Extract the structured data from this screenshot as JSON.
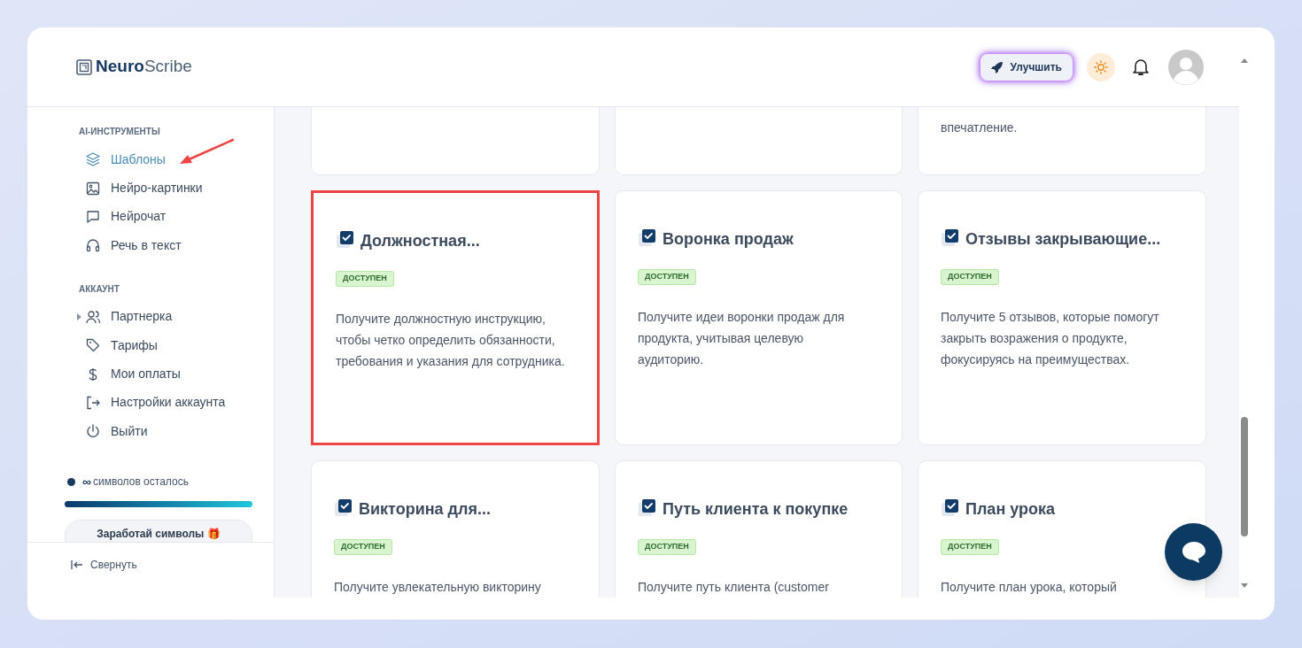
{
  "brand": {
    "bold": "Neuro",
    "light": "Scribe"
  },
  "header": {
    "upgrade_button": "Улучшить"
  },
  "sidebar": {
    "sections": [
      {
        "title": "AI-ИНСТРУМЕНТЫ",
        "items": [
          {
            "label": "Шаблоны",
            "selected": true
          },
          {
            "label": "Нейро-картинки",
            "selected": false
          },
          {
            "label": "Нейрочат",
            "selected": false
          },
          {
            "label": "Речь в текст",
            "selected": false
          }
        ]
      },
      {
        "title": "АККАУНТ",
        "items": [
          {
            "label": "Партнерка",
            "selected": false,
            "expandable": true
          },
          {
            "label": "Тарифы",
            "selected": false
          },
          {
            "label": "Мои оплаты",
            "selected": false
          },
          {
            "label": "Настройки аккаунта",
            "selected": false
          },
          {
            "label": "Выйти",
            "selected": false
          }
        ]
      }
    ],
    "credits": {
      "amount": "∞",
      "label": "символов осталось",
      "level": 1
    },
    "earn_button": "Заработай символы 🎁",
    "collapse": "Свернуть"
  },
  "cards": [
    {
      "highlighted": false
    },
    {
      "highlighted": false
    },
    {
      "description": "впечатление.",
      "highlighted": false
    },
    {
      "title": "Должностная...",
      "badge": "ДОСТУПЕН",
      "description": "Получите должностную инструкцию, чтобы четко определить обязанности, требования и указания для сотрудника.",
      "highlighted": true
    },
    {
      "title": "Воронка продаж",
      "badge": "ДОСТУПЕН",
      "description": "Получите идеи воронки продаж для продукта, учитывая целевую аудиторию.",
      "highlighted": false
    },
    {
      "title": "Отзывы закрывающие...",
      "badge": "ДОСТУПЕН",
      "description": "Получите 5 отзывов, которые помогут закрыть возражения о продукте, фокусируясь на преимуществах.",
      "highlighted": false
    },
    {
      "title": "Викторина для...",
      "badge": "ДОСТУПЕН",
      "description": "Получите увлекательную викторину",
      "highlighted": false
    },
    {
      "title": "Путь клиента к покупке",
      "badge": "ДОСТУПЕН",
      "description": "Получите путь клиента (customer",
      "highlighted": false
    },
    {
      "title": "План урока",
      "badge": "ДОСТУПЕН",
      "description": "Получите план урока, который",
      "highlighted": false
    }
  ]
}
